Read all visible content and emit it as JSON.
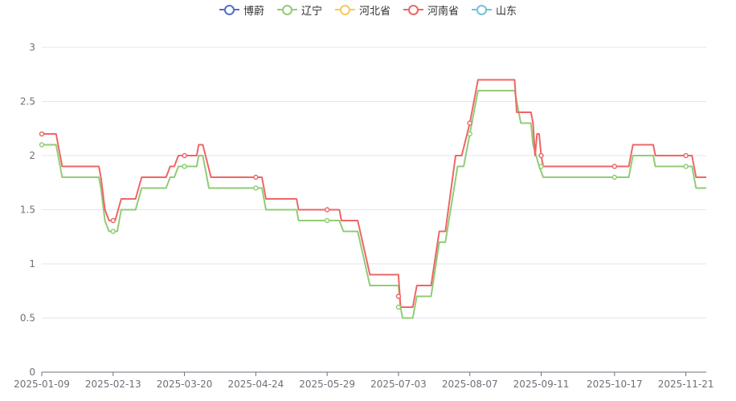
{
  "chart_data": {
    "type": "line",
    "legend": {
      "position": "top-center",
      "items": [
        {
          "name": "博蔚",
          "color": "#5470c6"
        },
        {
          "name": "辽宁",
          "color": "#91cc75"
        },
        {
          "name": "河北省",
          "color": "#fac858"
        },
        {
          "name": "河南省",
          "color": "#ee6666"
        },
        {
          "name": "山东",
          "color": "#73c0de"
        }
      ]
    },
    "grid": true,
    "ylim": [
      0,
      3
    ],
    "yticks": [
      "0",
      "0.5",
      "1",
      "1.5",
      "2",
      "2.5",
      "3"
    ],
    "xlim": [
      "2025-01-09",
      "2025-12-01"
    ],
    "xticks": [
      "2025-01-09",
      "2025-02-13",
      "2025-03-20",
      "2025-04-24",
      "2025-05-29",
      "2025-07-03",
      "2025-08-07",
      "2025-09-11",
      "2025-10-17",
      "2025-11-21"
    ],
    "series": [
      {
        "name": "辽宁",
        "color": "#91cc75",
        "points": [
          [
            "2025-01-09",
            2.1
          ],
          [
            "2025-01-16",
            2.1
          ],
          [
            "2025-01-19",
            1.8
          ],
          [
            "2025-01-31",
            1.8
          ],
          [
            "2025-02-06",
            1.8
          ],
          [
            "2025-02-07",
            1.7
          ],
          [
            "2025-02-09",
            1.4
          ],
          [
            "2025-02-11",
            1.3
          ],
          [
            "2025-02-15",
            1.3
          ],
          [
            "2025-02-17",
            1.5
          ],
          [
            "2025-02-24",
            1.5
          ],
          [
            "2025-02-27",
            1.7
          ],
          [
            "2025-03-11",
            1.7
          ],
          [
            "2025-03-13",
            1.8
          ],
          [
            "2025-03-15",
            1.8
          ],
          [
            "2025-03-17",
            1.9
          ],
          [
            "2025-03-26",
            1.9
          ],
          [
            "2025-03-27",
            2.0
          ],
          [
            "2025-03-29",
            2.0
          ],
          [
            "2025-04-01",
            1.7
          ],
          [
            "2025-04-24",
            1.7
          ],
          [
            "2025-04-27",
            1.7
          ],
          [
            "2025-04-29",
            1.5
          ],
          [
            "2025-05-14",
            1.5
          ],
          [
            "2025-05-15",
            1.4
          ],
          [
            "2025-05-29",
            1.4
          ],
          [
            "2025-06-04",
            1.4
          ],
          [
            "2025-06-06",
            1.3
          ],
          [
            "2025-06-13",
            1.3
          ],
          [
            "2025-06-19",
            0.8
          ],
          [
            "2025-07-03",
            0.8
          ],
          [
            "2025-07-04",
            0.6
          ],
          [
            "2025-07-05",
            0.5
          ],
          [
            "2025-07-10",
            0.5
          ],
          [
            "2025-07-12",
            0.7
          ],
          [
            "2025-07-19",
            0.7
          ],
          [
            "2025-07-23",
            1.2
          ],
          [
            "2025-07-26",
            1.2
          ],
          [
            "2025-08-01",
            1.9
          ],
          [
            "2025-08-04",
            1.9
          ],
          [
            "2025-08-07",
            2.2
          ],
          [
            "2025-08-11",
            2.6
          ],
          [
            "2025-08-22",
            2.6
          ],
          [
            "2025-08-29",
            2.6
          ],
          [
            "2025-09-01",
            2.3
          ],
          [
            "2025-09-06",
            2.3
          ],
          [
            "2025-09-07",
            2.1
          ],
          [
            "2025-09-10",
            1.9
          ],
          [
            "2025-09-12",
            1.8
          ],
          [
            "2025-10-17",
            1.8
          ],
          [
            "2025-10-24",
            1.8
          ],
          [
            "2025-10-26",
            2.0
          ],
          [
            "2025-11-05",
            2.0
          ],
          [
            "2025-11-06",
            1.9
          ],
          [
            "2025-11-21",
            1.9
          ],
          [
            "2025-11-24",
            1.9
          ],
          [
            "2025-11-26",
            1.7
          ],
          [
            "2025-12-01",
            1.7
          ]
        ],
        "markers": [
          [
            "2025-01-09",
            2.1
          ],
          [
            "2025-02-13",
            1.3
          ],
          [
            "2025-03-20",
            1.9
          ],
          [
            "2025-04-24",
            1.7
          ],
          [
            "2025-05-29",
            1.4
          ],
          [
            "2025-07-03",
            0.6
          ],
          [
            "2025-08-07",
            2.2
          ],
          [
            "2025-09-11",
            1.9
          ],
          [
            "2025-10-17",
            1.8
          ],
          [
            "2025-11-21",
            1.9
          ]
        ]
      },
      {
        "name": "河南省",
        "color": "#ee6666",
        "points": [
          [
            "2025-01-09",
            2.2
          ],
          [
            "2025-01-16",
            2.2
          ],
          [
            "2025-01-19",
            1.9
          ],
          [
            "2025-02-06",
            1.9
          ],
          [
            "2025-02-07",
            1.8
          ],
          [
            "2025-02-09",
            1.5
          ],
          [
            "2025-02-11",
            1.4
          ],
          [
            "2025-02-14",
            1.4
          ],
          [
            "2025-02-17",
            1.6
          ],
          [
            "2025-02-24",
            1.6
          ],
          [
            "2025-02-27",
            1.8
          ],
          [
            "2025-03-11",
            1.8
          ],
          [
            "2025-03-13",
            1.9
          ],
          [
            "2025-03-15",
            1.9
          ],
          [
            "2025-03-17",
            2.0
          ],
          [
            "2025-03-26",
            2.0
          ],
          [
            "2025-03-27",
            2.1
          ],
          [
            "2025-03-29",
            2.1
          ],
          [
            "2025-04-02",
            1.8
          ],
          [
            "2025-04-24",
            1.8
          ],
          [
            "2025-04-27",
            1.8
          ],
          [
            "2025-04-29",
            1.6
          ],
          [
            "2025-05-14",
            1.6
          ],
          [
            "2025-05-15",
            1.5
          ],
          [
            "2025-05-29",
            1.5
          ],
          [
            "2025-06-04",
            1.5
          ],
          [
            "2025-06-05",
            1.4
          ],
          [
            "2025-06-13",
            1.4
          ],
          [
            "2025-06-19",
            0.9
          ],
          [
            "2025-07-03",
            0.9
          ],
          [
            "2025-07-04",
            0.6
          ],
          [
            "2025-07-10",
            0.6
          ],
          [
            "2025-07-12",
            0.8
          ],
          [
            "2025-07-19",
            0.8
          ],
          [
            "2025-07-23",
            1.3
          ],
          [
            "2025-07-26",
            1.3
          ],
          [
            "2025-07-31",
            2.0
          ],
          [
            "2025-08-03",
            2.0
          ],
          [
            "2025-08-07",
            2.3
          ],
          [
            "2025-08-11",
            2.7
          ],
          [
            "2025-08-29",
            2.7
          ],
          [
            "2025-08-30",
            2.4
          ],
          [
            "2025-09-06",
            2.4
          ],
          [
            "2025-09-07",
            2.3
          ],
          [
            "2025-09-08",
            2.0
          ],
          [
            "2025-09-09",
            2.2
          ],
          [
            "2025-09-10",
            2.2
          ],
          [
            "2025-09-11",
            2.0
          ],
          [
            "2025-09-12",
            1.9
          ],
          [
            "2025-10-17",
            1.9
          ],
          [
            "2025-10-24",
            1.9
          ],
          [
            "2025-10-26",
            2.1
          ],
          [
            "2025-11-05",
            2.1
          ],
          [
            "2025-11-06",
            2.0
          ],
          [
            "2025-11-24",
            2.0
          ],
          [
            "2025-11-26",
            1.8
          ],
          [
            "2025-12-01",
            1.8
          ]
        ],
        "markers": [
          [
            "2025-01-09",
            2.2
          ],
          [
            "2025-02-13",
            1.4
          ],
          [
            "2025-03-20",
            2.0
          ],
          [
            "2025-04-24",
            1.8
          ],
          [
            "2025-05-29",
            1.5
          ],
          [
            "2025-07-03",
            0.7
          ],
          [
            "2025-08-07",
            2.3
          ],
          [
            "2025-09-11",
            2.0
          ],
          [
            "2025-10-17",
            1.9
          ],
          [
            "2025-11-21",
            2.0
          ]
        ]
      }
    ]
  }
}
